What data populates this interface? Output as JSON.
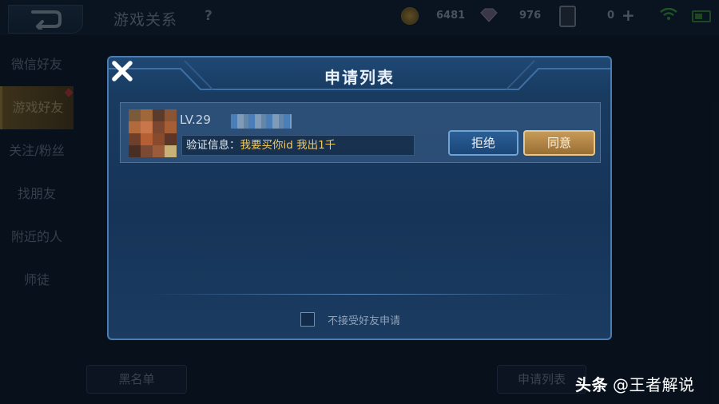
{
  "header": {
    "title": "游戏关系",
    "help": "?",
    "resources": {
      "gold": "6481",
      "diamonds": "976",
      "cards": "0"
    },
    "icons": [
      "back-icon",
      "help-icon",
      "gold-coin-icon",
      "diamond-icon",
      "card-icon",
      "plus-icon",
      "wifi-icon",
      "battery-icon"
    ]
  },
  "sidebar": {
    "items": [
      {
        "label": "微信好友"
      },
      {
        "label": "游戏好友"
      },
      {
        "label": "关注/粉丝"
      },
      {
        "label": "找朋友"
      },
      {
        "label": "附近的人"
      },
      {
        "label": "师徒"
      }
    ],
    "active_index": 1
  },
  "footer": {
    "blacklist_label": "黑名单",
    "request_list_label": "申请列表"
  },
  "modal": {
    "title": "申请列表",
    "requests": [
      {
        "level": "LV.29",
        "verify_label": "验证信息：",
        "verify_message": "我要买你id 我出1千",
        "reject_label": "拒绝",
        "accept_label": "同意"
      }
    ],
    "decline_all_label": "不接受好友申请",
    "decline_all_checked": false
  },
  "watermark": {
    "brand": "头条",
    "author": "@王者解说"
  },
  "colors": {
    "accent_gold": "#c79a58",
    "accent_blue": "#2a5f97",
    "message_yellow": "#f2c95c"
  }
}
